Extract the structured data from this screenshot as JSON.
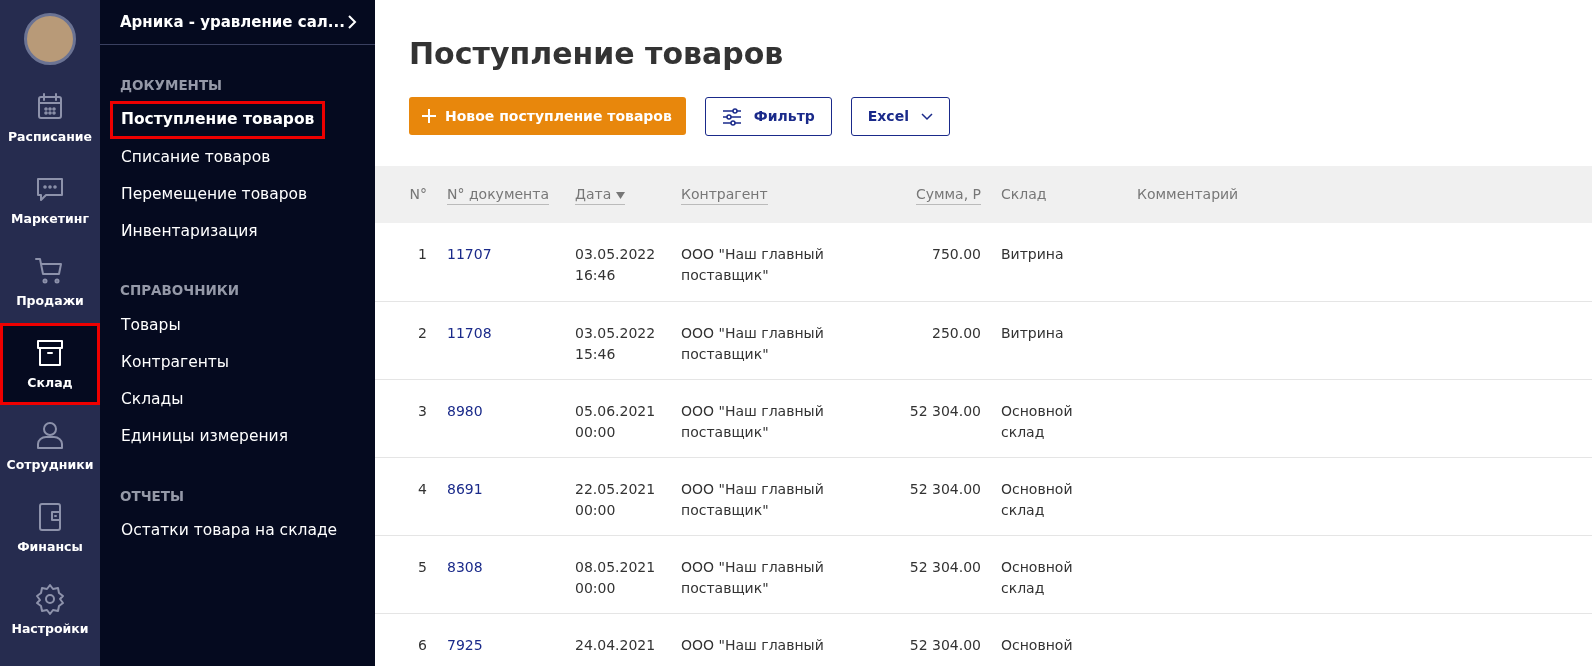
{
  "rail": {
    "items": [
      {
        "label": "Расписание",
        "kind": "calendar",
        "selected": false,
        "highlighted": false
      },
      {
        "label": "Маркетинг",
        "kind": "chat",
        "selected": false,
        "highlighted": false
      },
      {
        "label": "Продажи",
        "kind": "cart",
        "selected": false,
        "highlighted": false
      },
      {
        "label": "Склад",
        "kind": "box",
        "selected": true,
        "highlighted": true
      },
      {
        "label": "Сотрудники",
        "kind": "person",
        "selected": false,
        "highlighted": false
      },
      {
        "label": "Финансы",
        "kind": "wallet",
        "selected": false,
        "highlighted": false
      },
      {
        "label": "Настройки",
        "kind": "gear",
        "selected": false,
        "highlighted": false
      }
    ]
  },
  "submenu": {
    "title": "Арника - уравление сал...",
    "sections": [
      {
        "heading": "ДОКУМЕНТЫ",
        "items": [
          {
            "label": "Поступление товаров",
            "selected": true,
            "highlighted": true
          },
          {
            "label": "Списание товаров",
            "selected": false,
            "highlighted": false
          },
          {
            "label": "Перемещение товаров",
            "selected": false,
            "highlighted": false
          },
          {
            "label": "Инвентаризация",
            "selected": false,
            "highlighted": false
          }
        ]
      },
      {
        "heading": "СПРАВОЧНИКИ",
        "items": [
          {
            "label": "Товары",
            "selected": false,
            "highlighted": false
          },
          {
            "label": "Контрагенты",
            "selected": false,
            "highlighted": false
          },
          {
            "label": "Склады",
            "selected": false,
            "highlighted": false
          },
          {
            "label": "Единицы измерения",
            "selected": false,
            "highlighted": false
          }
        ]
      },
      {
        "heading": "ОТЧЕТЫ",
        "items": [
          {
            "label": "Остатки товара на складе",
            "selected": false,
            "highlighted": false
          }
        ]
      }
    ]
  },
  "page": {
    "title": "Поступление товаров",
    "buttons": [
      {
        "kind": "add",
        "label": "Новое поступление товаров"
      },
      {
        "kind": "filter",
        "label": "Фильтр"
      },
      {
        "kind": "dropdown",
        "label": "Excel"
      }
    ]
  },
  "table": {
    "columns": [
      {
        "label": "N°",
        "kind": "number",
        "sortable": false,
        "sorted": false
      },
      {
        "label": "N° документа",
        "kind": "text",
        "sortable": true,
        "sorted": false
      },
      {
        "label": "Дата",
        "kind": "text",
        "sortable": true,
        "sorted": true
      },
      {
        "label": "Контрагент",
        "kind": "text",
        "sortable": true,
        "sorted": false
      },
      {
        "label": "Сумма, Р",
        "kind": "number",
        "sortable": true,
        "sorted": false
      },
      {
        "label": "Склад",
        "kind": "text",
        "sortable": false,
        "sorted": false
      },
      {
        "label": "Комментарий",
        "kind": "text",
        "sortable": false,
        "sorted": false
      }
    ],
    "rows": [
      [
        "1",
        "11707",
        "03.05.2022 16:46",
        "ООО \"Наш главный поставщик\"",
        "750.00",
        "Витрина"
      ],
      [
        "2",
        "11708",
        "03.05.2022 15:46",
        "ООО \"Наш главный поставщик\"",
        "250.00",
        "Витрина"
      ],
      [
        "3",
        "8980",
        "05.06.2021 00:00",
        "ООО \"Наш главный поставщик\"",
        "52 304.00",
        "Основной склад"
      ],
      [
        "4",
        "8691",
        "22.05.2021 00:00",
        "ООО \"Наш главный поставщик\"",
        "52 304.00",
        "Основной склад"
      ],
      [
        "5",
        "8308",
        "08.05.2021 00:00",
        "ООО \"Наш главный поставщик\"",
        "52 304.00",
        "Основной склад"
      ],
      [
        "6",
        "7925",
        "24.04.2021",
        "ООО \"Наш главный",
        "52 304.00",
        "Основной"
      ]
    ]
  }
}
